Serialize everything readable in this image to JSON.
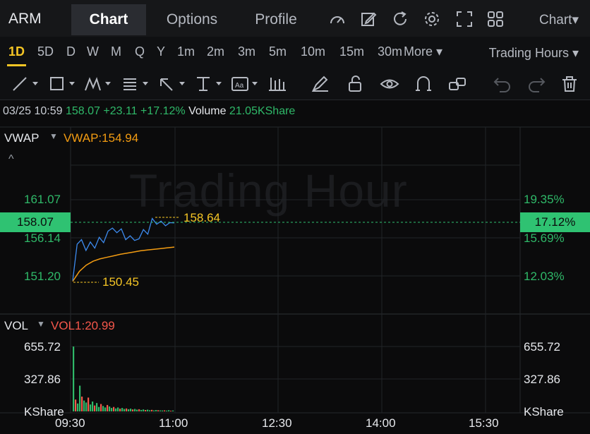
{
  "header": {
    "ticker": "ARM",
    "tabs": [
      {
        "label": "Chart",
        "active": true
      },
      {
        "label": "Options",
        "active": false
      },
      {
        "label": "Profile",
        "active": false
      }
    ],
    "icons": [
      "gauge-icon",
      "edit-icon",
      "refresh-icon",
      "settings-icon",
      "fullscreen-icon",
      "layout-grid-icon"
    ],
    "chart_menu": "Chart▾"
  },
  "periods": {
    "items": [
      "1D",
      "5D",
      "D",
      "W",
      "M",
      "Q",
      "Y",
      "1m",
      "2m",
      "3m",
      "5m",
      "10m",
      "15m",
      "30m"
    ],
    "active": "1D",
    "more": "More ▾",
    "session": "Trading Hours ▾"
  },
  "toolbar": [
    "trendline-tool-icon",
    "rectangle-tool-icon",
    "pattern-tool-icon",
    "fib-tool-icon",
    "arrow-tool-icon",
    "measure-tool-icon",
    "text-tool-icon",
    "bars-tool-icon",
    "brush-icon",
    "unlock-icon",
    "eye-icon",
    "magnet-icon",
    "link-icon",
    "undo-icon",
    "redo-icon",
    "trash-icon"
  ],
  "quote": {
    "datetime": "03/25 10:59",
    "price": "158.07",
    "change": "+23.11",
    "change_pct": "+17.12%",
    "volume_label": "Volume",
    "volume": "21.05KShare"
  },
  "price_panel": {
    "indicator": "VWAP",
    "indicator_value": "VWAP:154.94",
    "collapse_glyph": "^",
    "watermark": "Trading Hour",
    "left_ticks": [
      "161.07",
      "156.14",
      "151.20"
    ],
    "right_ticks": [
      "19.35%",
      "15.69%",
      "12.03%"
    ],
    "current_price": "158.07",
    "current_pct": "17.12%",
    "high_label": "158.64",
    "low_label": "150.45"
  },
  "volume_panel": {
    "indicator": "VOL",
    "indicator_value": "VOL1:20.99",
    "left_ticks": [
      "655.72",
      "327.86",
      "KShare"
    ],
    "right_ticks": [
      "655.72",
      "327.86",
      "KShare"
    ]
  },
  "time_axis": [
    "09:30",
    "11:00",
    "12:30",
    "14:00",
    "15:30"
  ],
  "colors": {
    "accent": "#f5c525",
    "up": "#2fb969",
    "down": "#f5574b",
    "price_line": "#3d8bef",
    "vwap_line": "#f39c12"
  },
  "chart_data": {
    "type": "line",
    "series": [
      {
        "name": "VWAP",
        "values": [
          150.5,
          151.8,
          152.6,
          153.1,
          153.4,
          153.6,
          153.8,
          154.0,
          154.15,
          154.3,
          154.45,
          154.55,
          154.65,
          154.75,
          154.85,
          154.94
        ]
      }
    ],
    "price_points": [
      150.6,
      155.3,
      155.9,
      154.5,
      155.6,
      154.8,
      156.2,
      155.5,
      157.0,
      157.4,
      156.8,
      157.3,
      155.9,
      156.4,
      155.8,
      156.0,
      157.2,
      156.6,
      158.64,
      157.9,
      158.3,
      157.7,
      158.1,
      158.07
    ],
    "ylim": [
      149.6,
      163.2
    ],
    "x": [
      "09:30",
      "11:00",
      "12:30",
      "14:00",
      "15:30"
    ],
    "volume": [
      655,
      120,
      80,
      260,
      150,
      110,
      90,
      140,
      70,
      100,
      60,
      85,
      45,
      75,
      55,
      40,
      65,
      50,
      35,
      45,
      30,
      40,
      28,
      35,
      25,
      30,
      22,
      28,
      20,
      25,
      18,
      22,
      15,
      20,
      14,
      18,
      12,
      16,
      10,
      14,
      12,
      10,
      9,
      11,
      8,
      12,
      7,
      9
    ],
    "volume_ylim": [
      0,
      700
    ]
  }
}
